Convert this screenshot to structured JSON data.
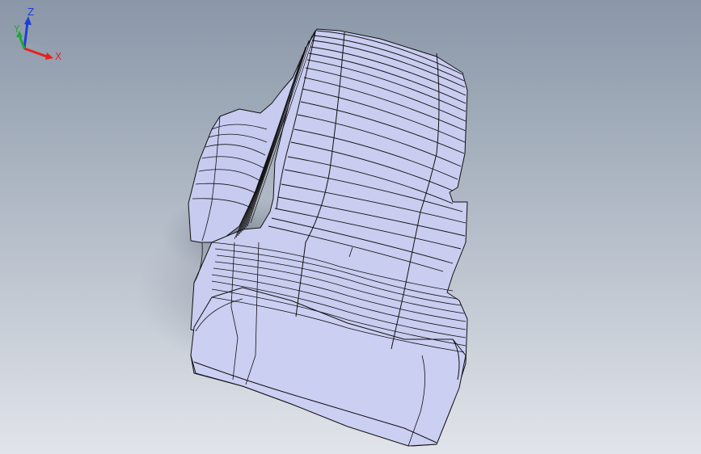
{
  "viewport": {
    "background_top": "#8a97a8",
    "background_bottom": "#dde1e7",
    "model_fill": "#c9cdf0",
    "model_fill_dark": "#b4b9e8",
    "edge_color": "#111111",
    "shadow_color": "#7c8594"
  },
  "triad": {
    "x_label": "X",
    "y_label": "Y",
    "z_label": "Z",
    "x_color": "#e8201e",
    "y_color": "#1fa83a",
    "z_color": "#1b3fd6"
  }
}
